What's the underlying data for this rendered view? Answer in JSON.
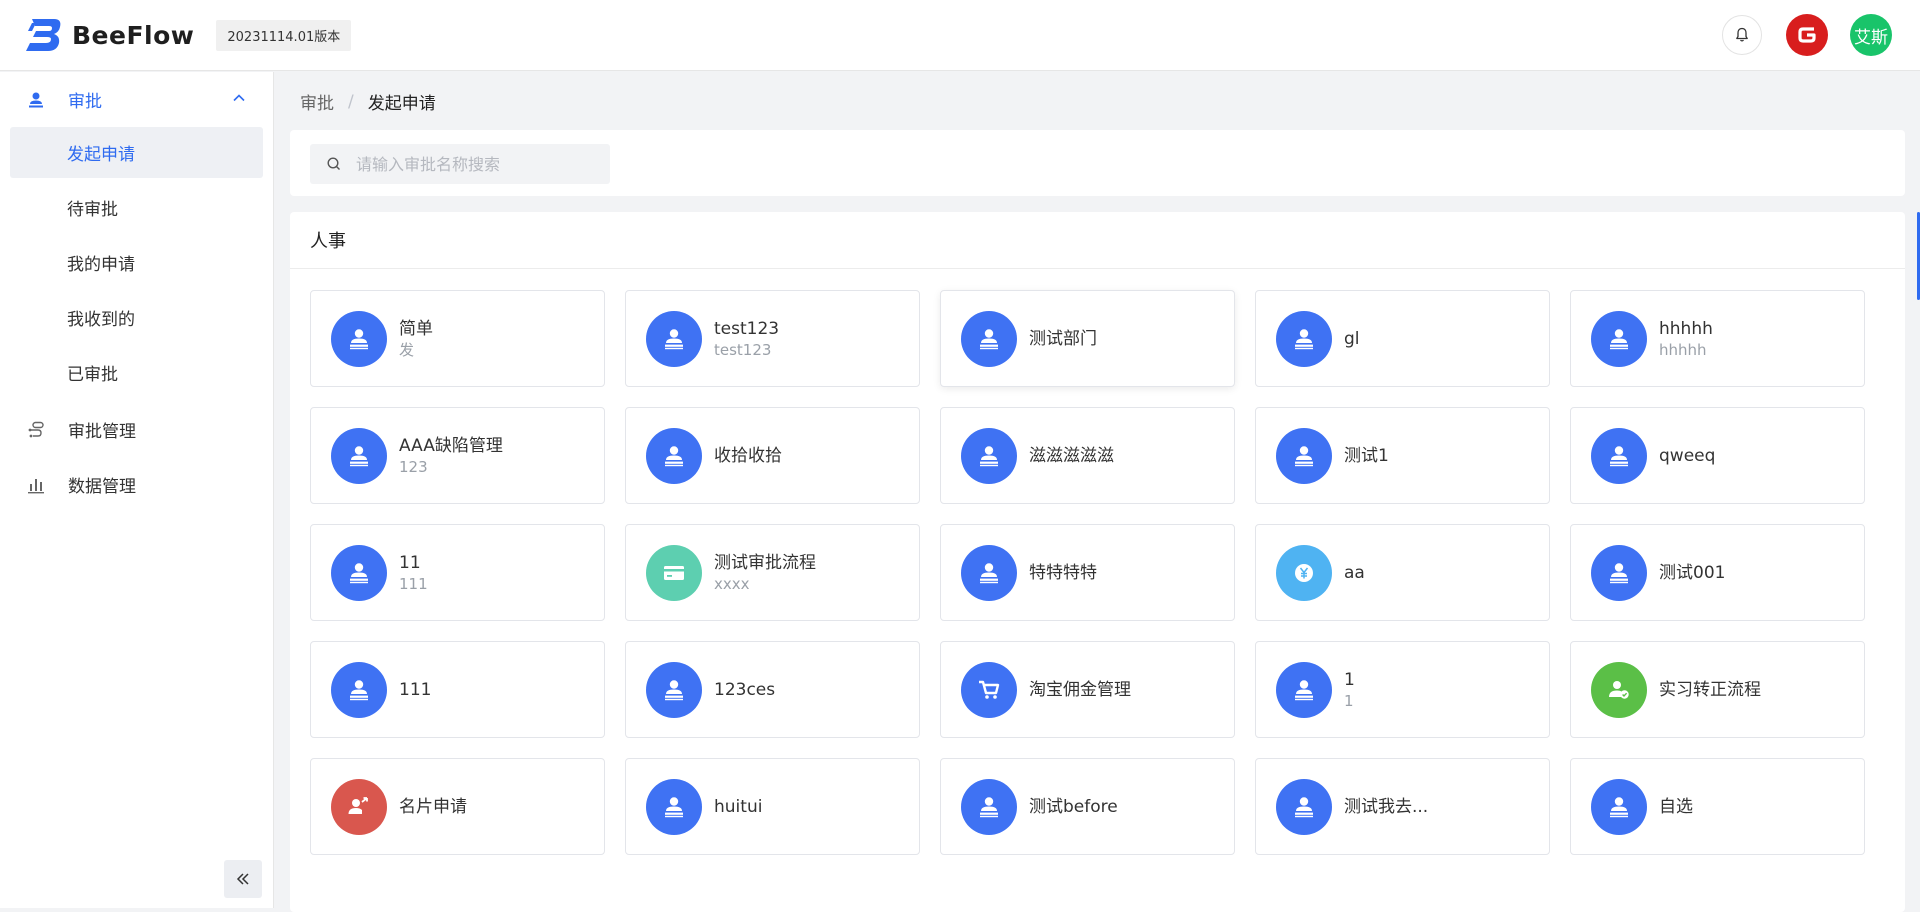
{
  "header": {
    "brand": "BeeFlow",
    "version": "20231114.01版本",
    "user_avatar_text": "艾斯"
  },
  "sidebar": {
    "groups": [
      {
        "label": "审批",
        "icon": "user-stamp-icon",
        "expanded": true,
        "items": [
          {
            "label": "发起申请",
            "active": true
          },
          {
            "label": "待审批"
          },
          {
            "label": "我的申请"
          },
          {
            "label": "我收到的"
          },
          {
            "label": "已审批"
          }
        ]
      },
      {
        "label": "审批管理",
        "icon": "flow-icon"
      },
      {
        "label": "数据管理",
        "icon": "bar-chart-icon"
      }
    ]
  },
  "breadcrumb": {
    "parent": "审批",
    "separator": "/",
    "current": "发起申请"
  },
  "search": {
    "placeholder": "请输入审批名称搜索",
    "value": ""
  },
  "category": {
    "title": "人事",
    "items": [
      {
        "name": "简单",
        "desc": "发",
        "icon": "stamp",
        "color": "#3f72f3"
      },
      {
        "name": "test123",
        "desc": "test123",
        "icon": "stamp",
        "color": "#3f72f3"
      },
      {
        "name": "测试部门",
        "desc": "",
        "icon": "stamp",
        "color": "#3f72f3"
      },
      {
        "name": "gl",
        "desc": "",
        "icon": "stamp",
        "color": "#3f72f3"
      },
      {
        "name": "hhhhh",
        "desc": "hhhhh",
        "icon": "stamp",
        "color": "#3f72f3"
      },
      {
        "name": "AAA缺陷管理",
        "desc": "123",
        "icon": "stamp",
        "color": "#3f72f3"
      },
      {
        "name": "收拾收拾",
        "desc": "",
        "icon": "stamp",
        "color": "#3f72f3"
      },
      {
        "name": "滋滋滋滋滋",
        "desc": "",
        "icon": "stamp",
        "color": "#3f72f3"
      },
      {
        "name": "测试1",
        "desc": "",
        "icon": "stamp",
        "color": "#3f72f3"
      },
      {
        "name": "qweeq",
        "desc": "",
        "icon": "stamp",
        "color": "#3f72f3"
      },
      {
        "name": "11",
        "desc": "111",
        "icon": "stamp",
        "color": "#3f72f3"
      },
      {
        "name": "测试审批流程",
        "desc": "xxxx",
        "icon": "card",
        "color": "#5dcfb0"
      },
      {
        "name": "特特特特",
        "desc": "",
        "icon": "stamp",
        "color": "#3f72f3"
      },
      {
        "name": "aa",
        "desc": "",
        "icon": "yen",
        "color": "#4fb3f2"
      },
      {
        "name": "测试001",
        "desc": "",
        "icon": "stamp",
        "color": "#3f72f3"
      },
      {
        "name": "111",
        "desc": "",
        "icon": "stamp",
        "color": "#3f72f3"
      },
      {
        "name": "123ces",
        "desc": "",
        "icon": "stamp",
        "color": "#3f72f3"
      },
      {
        "name": "淘宝佣金管理",
        "desc": "",
        "icon": "cart",
        "color": "#3f72f3"
      },
      {
        "name": "1",
        "desc": "1",
        "icon": "stamp",
        "color": "#3f72f3"
      },
      {
        "name": "实习转正流程",
        "desc": "",
        "icon": "user-check",
        "color": "#5bbf47"
      },
      {
        "name": "名片申请",
        "desc": "",
        "icon": "user-share",
        "color": "#d9574e"
      },
      {
        "name": "huitui",
        "desc": "",
        "icon": "stamp",
        "color": "#3f72f3"
      },
      {
        "name": "测试before",
        "desc": "",
        "icon": "stamp",
        "color": "#3f72f3"
      },
      {
        "name": "测试我去...",
        "desc": "",
        "icon": "stamp",
        "color": "#3f72f3"
      },
      {
        "name": "自选",
        "desc": "",
        "icon": "stamp",
        "color": "#3f72f3"
      }
    ]
  },
  "colors": {
    "accent": "#2f6bf0",
    "stamp_blue": "#3f72f3"
  }
}
